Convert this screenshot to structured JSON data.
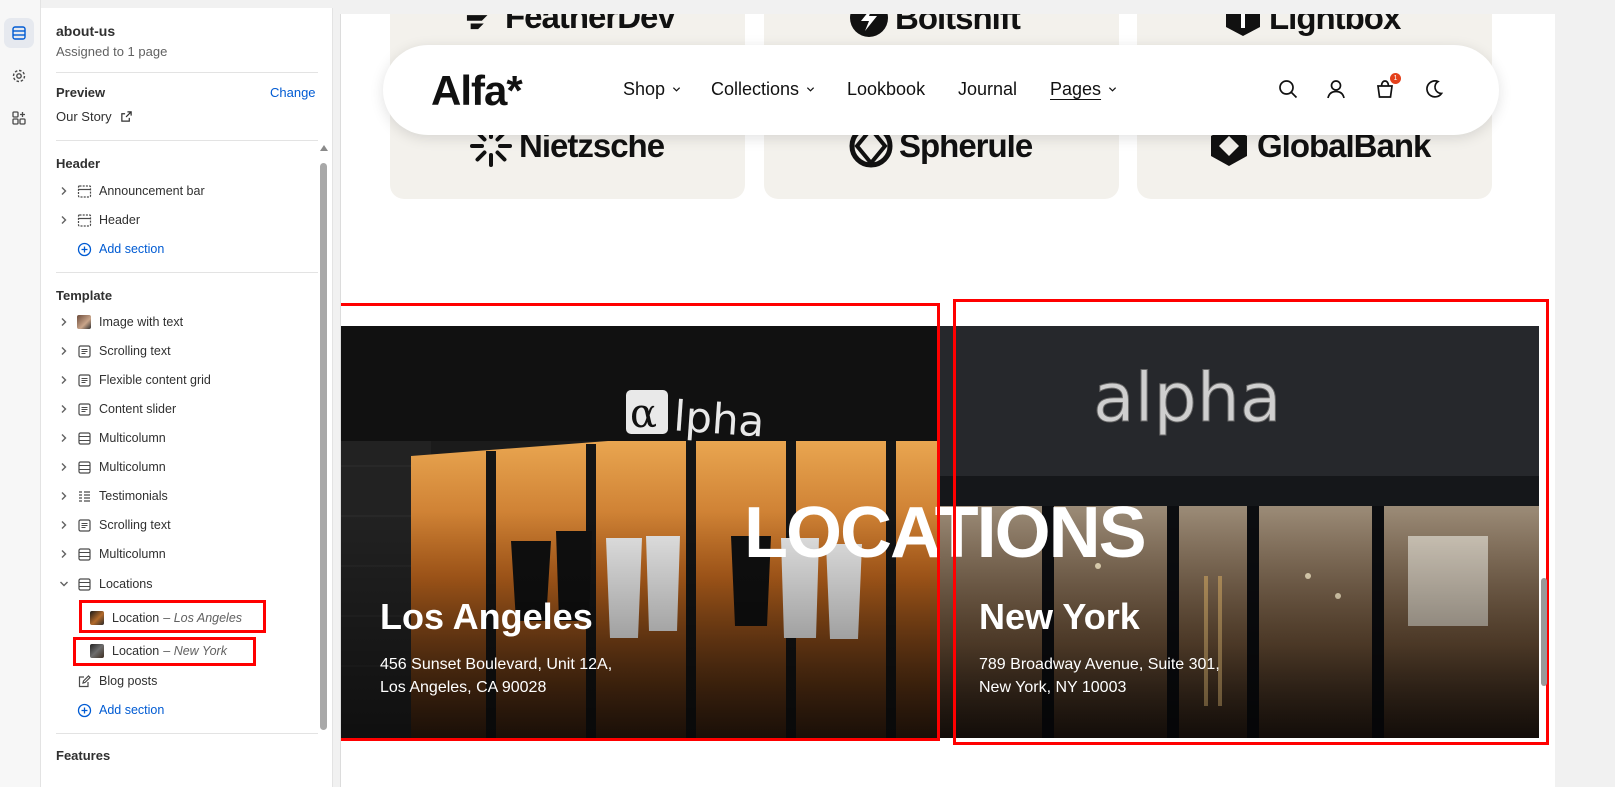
{
  "sidebar": {
    "page_name": "about-us",
    "page_sub": "Assigned to 1 page",
    "preview_label": "Preview",
    "change_link": "Change",
    "preview_value": "Our Story",
    "header_group": "Header",
    "header_items": [
      "Announcement bar",
      "Header"
    ],
    "add_section": "Add section",
    "template_group": "Template",
    "template_items": [
      "Image with text",
      "Scrolling text",
      "Flexible content grid",
      "Content slider",
      "Multicolumn",
      "Multicolumn",
      "Testimonials",
      "Scrolling text",
      "Multicolumn",
      "Locations"
    ],
    "location_children": [
      {
        "label": "Location",
        "sub": "– Los Angeles"
      },
      {
        "label": "Location",
        "sub": "– New York"
      }
    ],
    "blog_posts": "Blog posts",
    "features_group": "Features"
  },
  "canvas": {
    "logos_top": [
      "FeatherDev",
      "Boltshift",
      "Lightbox"
    ],
    "logos_bottom": [
      "Nietzsche",
      "Spherule",
      "GlobalBank"
    ],
    "nav": {
      "brand": "Alfa*",
      "links": [
        "Shop",
        "Collections",
        "Lookbook",
        "Journal",
        "Pages"
      ],
      "cart_count": "1"
    },
    "locations_heading": "LOCATIONS",
    "locations": [
      {
        "city": "Los Angeles",
        "address": "456 Sunset Boulevard, Unit 12A,\nLos Angeles, CA 90028",
        "sign": "αlpha"
      },
      {
        "city": "New York",
        "address": "789 Broadway Avenue, Suite 301,\nNew York, NY 10003",
        "sign": "alpha"
      }
    ]
  },
  "colors": {
    "accent_link": "#005bd3",
    "highlight": "#ff0000",
    "logo_card": "#f3f1ec"
  }
}
